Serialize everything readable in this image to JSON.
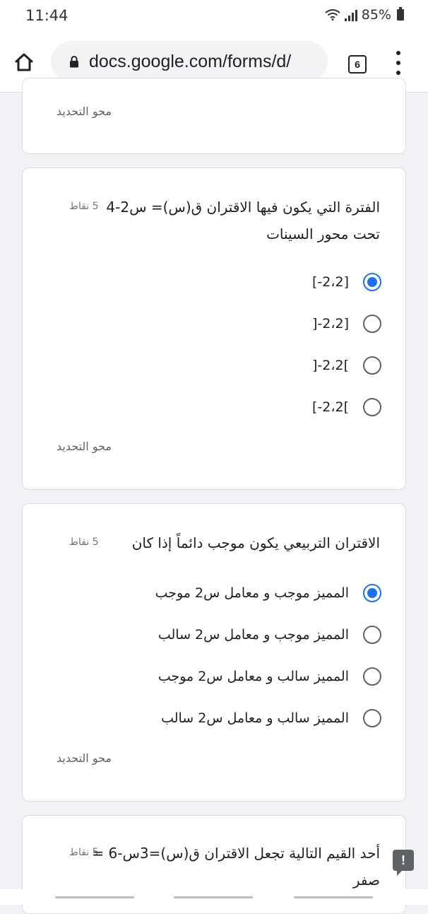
{
  "status": {
    "time": "11:44",
    "battery": "85%"
  },
  "browser": {
    "url": "docs.google.com/forms/d/",
    "tab_count": "6"
  },
  "card0": {
    "clear_label": "محو التحديد"
  },
  "question1": {
    "title_line1": "الفترة التي يكون فيها الاقتران ق(س)= س2-4",
    "title_line2": "تحت محور السينات",
    "points": "5 نقاط",
    "options": [
      "[-2،2]",
      "]-2،2]",
      "]-2،2[",
      "[-2،2["
    ],
    "selected_index": 0,
    "clear_label": "محو التحديد"
  },
  "question2": {
    "title": "الاقتران التربيعي يكون موجب دائماً إذا كان",
    "points": "5 نقاط",
    "options": [
      "المميز موجب و معامل س2 موجب",
      "المميز موجب و معامل س2 سالب",
      "المميز سالب و معامل س2 موجب",
      "المميز سالب و معامل س2 سالب"
    ],
    "selected_index": 0,
    "clear_label": "محو التحديد"
  },
  "question3": {
    "title_line1": "أحد القيم التالية تجعل الاقتران ق(س)=3س-6 =",
    "title_line2": "صفر",
    "points": "5 نقاط"
  },
  "colors": {
    "accent": "#1a73e8",
    "background": "#f0f2f5"
  }
}
